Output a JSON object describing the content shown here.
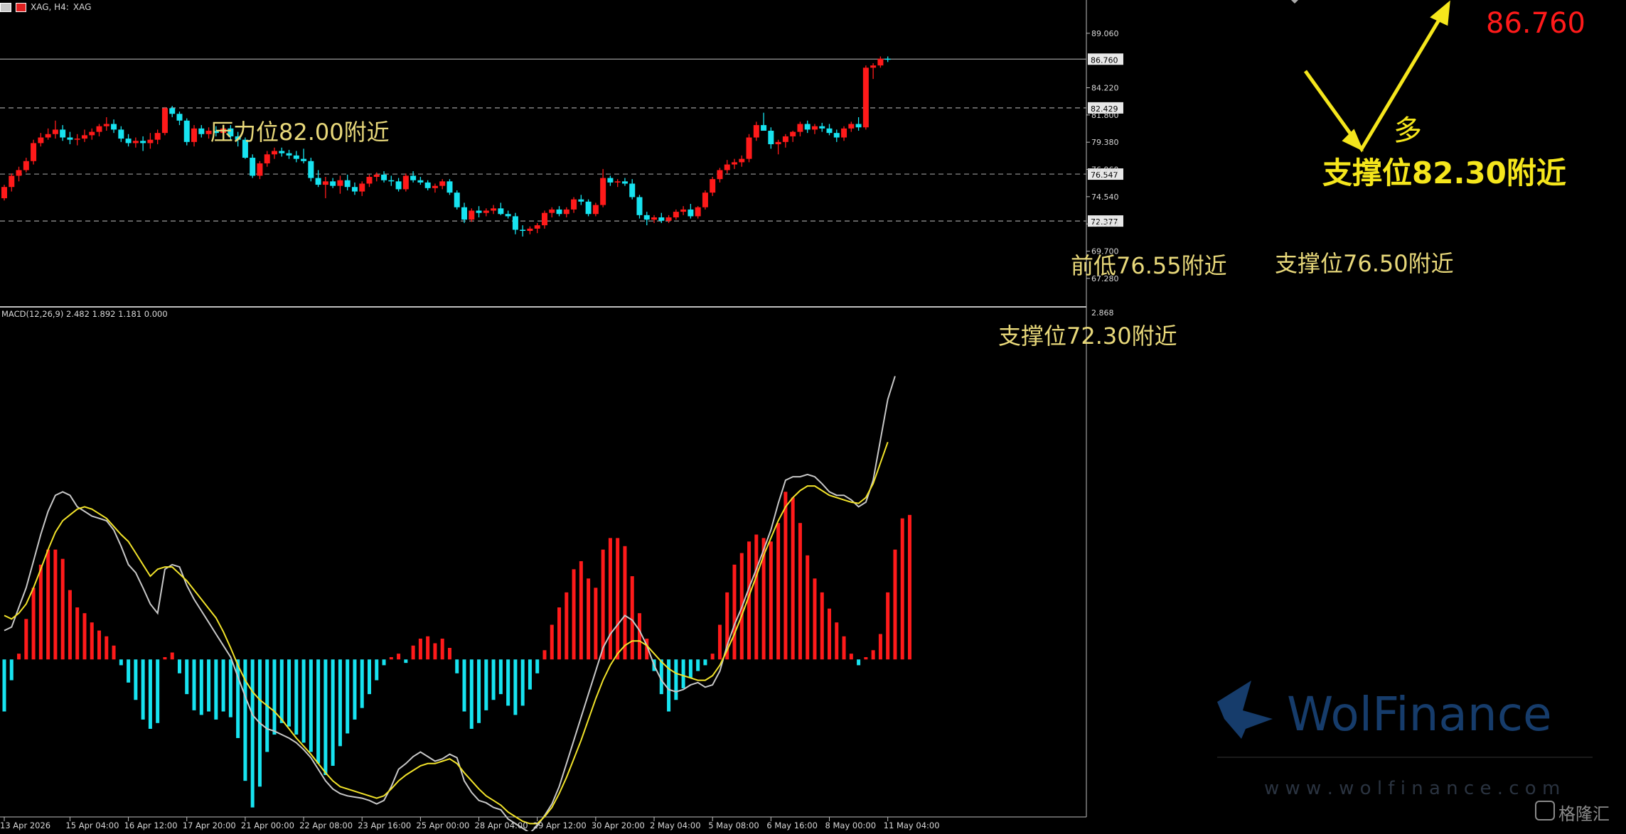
{
  "header": {
    "symbol": "XAG, H4:",
    "symbol_short": "XAG"
  },
  "macd_label": "MACD(12,26,9) 2.482 1.892 1.181 0.000",
  "big_price": "86.760",
  "colors": {
    "bull": "#ff1a1a",
    "bear": "#17e3f0",
    "annot": "#f5e61c",
    "annot_soft": "#e8d87a",
    "signal": "#f2e32a",
    "macd_line": "#c8c8c8",
    "grid": "#9a9a9a",
    "price_big": "#ff1a1a"
  },
  "annotations": {
    "resistance": "压力位82.00附近",
    "support_big": "支撑位82.30附近",
    "long": "多",
    "prev_low": "前低76.55附近",
    "support_mid": "支撑位76.50附近",
    "support_low": "支撑位72.30附近"
  },
  "watermark": {
    "brand": "WolFinance",
    "url": "w w w . w o l f i n a n c e . c o m",
    "corner": "格隆汇"
  },
  "chart_data": [
    {
      "type": "candlestick",
      "title": "XAG, H4",
      "y_ticks": [
        "89.060",
        "84.220",
        "81.800",
        "79.380",
        "76.960",
        "74.540",
        "72.120",
        "69.700",
        "67.280"
      ],
      "y_tick_values": [
        89.06,
        84.22,
        81.8,
        79.38,
        76.96,
        74.54,
        72.12,
        69.7,
        67.28
      ],
      "ylim": [
        65.0,
        90.5
      ],
      "x_ticks": [
        "13 Apr 2026",
        "15 Apr 04:00",
        "16 Apr 12:00",
        "17 Apr 20:00",
        "21 Apr 00:00",
        "22 Apr 08:00",
        "23 Apr 16:00",
        "25 Apr 00:00",
        "28 Apr 04:00",
        "29 Apr 12:00",
        "30 Apr 20:00",
        "2 May 04:00",
        "5 May 08:00",
        "6 May 16:00",
        "8 May 00:00",
        "11 May 04:00"
      ],
      "x_tick_index": [
        0,
        9,
        17,
        25,
        33,
        41,
        49,
        57,
        65,
        73,
        81,
        89,
        97,
        105,
        113,
        121
      ],
      "hlines": [
        {
          "value": 86.76,
          "label": "86.760",
          "style": "solid"
        },
        {
          "value": 82.429,
          "label": "82.429",
          "style": "dashed"
        },
        {
          "value": 76.547,
          "label": "76.547",
          "style": "dashed"
        },
        {
          "value": 72.377,
          "label": "72.377",
          "style": "dashed"
        }
      ],
      "candles": [
        [
          74.4,
          75.6,
          74.2,
          75.4
        ],
        [
          75.4,
          76.6,
          75.0,
          76.4
        ],
        [
          76.4,
          77.2,
          75.9,
          76.9
        ],
        [
          76.9,
          78.0,
          76.7,
          77.7
        ],
        [
          77.7,
          79.6,
          77.4,
          79.3
        ],
        [
          79.3,
          80.2,
          79.0,
          79.8
        ],
        [
          79.8,
          80.6,
          79.6,
          80.1
        ],
        [
          80.1,
          81.3,
          79.7,
          80.5
        ],
        [
          80.5,
          80.9,
          79.5,
          79.8
        ],
        [
          79.8,
          80.3,
          79.2,
          79.6
        ],
        [
          79.6,
          80.1,
          79.1,
          79.7
        ],
        [
          79.7,
          80.5,
          79.4,
          80.0
        ],
        [
          80.0,
          80.6,
          79.6,
          80.3
        ],
        [
          80.3,
          81.0,
          79.9,
          80.8
        ],
        [
          80.8,
          81.6,
          80.4,
          81.0
        ],
        [
          81.0,
          81.4,
          80.2,
          80.5
        ],
        [
          80.5,
          80.8,
          79.4,
          79.7
        ],
        [
          79.7,
          80.1,
          79.0,
          79.3
        ],
        [
          79.3,
          79.8,
          78.9,
          79.5
        ],
        [
          79.5,
          79.9,
          78.6,
          79.3
        ],
        [
          79.3,
          80.2,
          78.8,
          79.6
        ],
        [
          79.6,
          80.5,
          79.2,
          80.2
        ],
        [
          80.2,
          82.5,
          80.0,
          82.4
        ],
        [
          82.4,
          82.6,
          81.6,
          81.9
        ],
        [
          81.9,
          82.1,
          80.9,
          81.3
        ],
        [
          81.3,
          81.5,
          79.1,
          79.4
        ],
        [
          79.4,
          80.9,
          79.0,
          80.6
        ],
        [
          80.6,
          80.9,
          79.8,
          80.1
        ],
        [
          80.1,
          80.7,
          79.7,
          80.4
        ],
        [
          80.4,
          80.8,
          79.9,
          80.2
        ],
        [
          80.2,
          80.9,
          79.9,
          80.6
        ],
        [
          80.6,
          80.9,
          79.6,
          79.9
        ],
        [
          79.9,
          80.3,
          79.0,
          79.6
        ],
        [
          79.6,
          79.8,
          77.9,
          78.0
        ],
        [
          78.0,
          78.3,
          76.2,
          76.4
        ],
        [
          76.4,
          77.7,
          76.1,
          77.5
        ],
        [
          77.5,
          78.6,
          77.2,
          78.3
        ],
        [
          78.3,
          78.9,
          77.9,
          78.6
        ],
        [
          78.6,
          78.9,
          78.1,
          78.4
        ],
        [
          78.4,
          78.7,
          77.9,
          78.2
        ],
        [
          78.2,
          78.6,
          77.6,
          77.9
        ],
        [
          77.9,
          78.8,
          77.5,
          77.7
        ],
        [
          77.7,
          78.0,
          75.9,
          76.2
        ],
        [
          76.2,
          76.9,
          75.4,
          75.6
        ],
        [
          75.6,
          76.3,
          74.4,
          75.9
        ],
        [
          75.9,
          76.2,
          75.3,
          75.5
        ],
        [
          75.5,
          76.4,
          74.8,
          76.0
        ],
        [
          76.0,
          76.5,
          75.1,
          75.4
        ],
        [
          75.4,
          75.8,
          74.7,
          75.0
        ],
        [
          75.0,
          75.9,
          74.6,
          75.7
        ],
        [
          75.7,
          76.5,
          75.4,
          76.3
        ],
        [
          76.3,
          76.7,
          75.9,
          76.5
        ],
        [
          76.5,
          76.8,
          75.8,
          76.0
        ],
        [
          76.0,
          76.4,
          75.5,
          75.9
        ],
        [
          75.9,
          76.2,
          75.0,
          75.2
        ],
        [
          75.2,
          76.6,
          75.0,
          76.4
        ],
        [
          76.4,
          76.8,
          75.8,
          76.0
        ],
        [
          76.0,
          76.3,
          75.6,
          75.8
        ],
        [
          75.8,
          76.0,
          75.1,
          75.3
        ],
        [
          75.3,
          75.7,
          74.9,
          75.5
        ],
        [
          75.5,
          76.1,
          75.2,
          75.9
        ],
        [
          75.9,
          76.1,
          74.7,
          74.9
        ],
        [
          74.9,
          75.1,
          73.4,
          73.6
        ],
        [
          73.6,
          74.0,
          72.2,
          72.5
        ],
        [
          72.5,
          73.5,
          72.3,
          73.3
        ],
        [
          73.3,
          73.7,
          72.7,
          73.1
        ],
        [
          73.1,
          73.5,
          72.8,
          73.3
        ],
        [
          73.3,
          73.8,
          73.0,
          73.5
        ],
        [
          73.5,
          74.0,
          72.9,
          73.0
        ],
        [
          73.0,
          73.3,
          72.6,
          72.8
        ],
        [
          72.8,
          73.1,
          71.2,
          71.6
        ],
        [
          71.6,
          72.0,
          71.0,
          71.5
        ],
        [
          71.5,
          71.9,
          71.2,
          71.7
        ],
        [
          71.7,
          72.2,
          71.3,
          72.0
        ],
        [
          72.0,
          73.3,
          71.7,
          73.1
        ],
        [
          73.1,
          73.6,
          72.7,
          73.4
        ],
        [
          73.4,
          73.7,
          72.8,
          73.0
        ],
        [
          73.0,
          73.6,
          72.7,
          73.4
        ],
        [
          73.4,
          74.5,
          73.1,
          74.3
        ],
        [
          74.3,
          74.7,
          73.8,
          74.1
        ],
        [
          74.1,
          74.3,
          72.8,
          73.0
        ],
        [
          73.0,
          74.0,
          72.8,
          73.8
        ],
        [
          73.8,
          77.0,
          73.6,
          76.2
        ],
        [
          76.2,
          76.4,
          75.5,
          75.8
        ],
        [
          75.8,
          76.1,
          75.4,
          75.9
        ],
        [
          75.9,
          76.2,
          75.5,
          75.7
        ],
        [
          75.7,
          76.1,
          74.3,
          74.5
        ],
        [
          74.5,
          74.7,
          72.6,
          72.9
        ],
        [
          72.9,
          73.2,
          72.0,
          72.5
        ],
        [
          72.5,
          72.9,
          72.2,
          72.7
        ],
        [
          72.7,
          73.1,
          72.2,
          72.4
        ],
        [
          72.4,
          72.9,
          72.2,
          72.7
        ],
        [
          72.7,
          73.4,
          72.5,
          73.2
        ],
        [
          73.2,
          73.7,
          72.9,
          73.4
        ],
        [
          73.4,
          73.9,
          72.6,
          72.8
        ],
        [
          72.8,
          73.7,
          72.6,
          73.6
        ],
        [
          73.6,
          75.1,
          73.4,
          74.9
        ],
        [
          74.9,
          76.3,
          74.6,
          76.1
        ],
        [
          76.1,
          77.1,
          75.8,
          76.9
        ],
        [
          76.9,
          77.8,
          76.6,
          77.4
        ],
        [
          77.4,
          77.9,
          77.0,
          77.6
        ],
        [
          77.6,
          78.2,
          77.2,
          77.9
        ],
        [
          77.9,
          80.1,
          77.6,
          79.8
        ],
        [
          79.8,
          81.2,
          79.5,
          80.9
        ],
        [
          80.9,
          82.0,
          80.5,
          80.4
        ],
        [
          80.4,
          80.7,
          78.8,
          79.2
        ],
        [
          79.2,
          79.6,
          78.3,
          79.4
        ],
        [
          79.4,
          80.1,
          78.9,
          79.9
        ],
        [
          79.9,
          80.4,
          79.4,
          80.3
        ],
        [
          80.3,
          81.2,
          79.9,
          81.0
        ],
        [
          81.0,
          81.3,
          80.2,
          80.5
        ],
        [
          80.5,
          81.0,
          80.1,
          80.8
        ],
        [
          80.8,
          81.1,
          80.3,
          80.6
        ],
        [
          80.6,
          81.0,
          80.0,
          80.2
        ],
        [
          80.2,
          80.5,
          79.4,
          79.8
        ],
        [
          79.8,
          80.8,
          79.5,
          80.6
        ],
        [
          80.6,
          81.2,
          80.3,
          81.0
        ],
        [
          81.0,
          81.6,
          80.4,
          80.7
        ],
        [
          80.7,
          86.2,
          80.5,
          86.0
        ],
        [
          86.0,
          86.4,
          85.0,
          86.2
        ],
        [
          86.2,
          87.0,
          86.0,
          86.8
        ],
        [
          86.8,
          87.0,
          86.5,
          86.76
        ]
      ]
    },
    {
      "type": "bar",
      "title": "MACD(12,26,9)",
      "values_label": [
        "2.482",
        "1.892",
        "1.181",
        "0.000"
      ],
      "y_ticks": [
        "2.868"
      ],
      "ylim": [
        -1.35,
        3.0
      ],
      "hist": [
        -0.45,
        -0.18,
        0.05,
        0.35,
        0.62,
        0.82,
        0.95,
        0.95,
        0.87,
        0.6,
        0.45,
        0.4,
        0.32,
        0.25,
        0.2,
        0.12,
        -0.05,
        -0.2,
        -0.35,
        -0.52,
        -0.6,
        -0.55,
        0.02,
        0.06,
        -0.12,
        -0.3,
        -0.44,
        -0.48,
        -0.45,
        -0.52,
        -0.45,
        -0.5,
        -0.68,
        -1.05,
        -1.28,
        -1.1,
        -0.8,
        -0.65,
        -0.55,
        -0.58,
        -0.65,
        -0.72,
        -0.8,
        -0.9,
        -1.0,
        -0.92,
        -0.75,
        -0.64,
        -0.52,
        -0.42,
        -0.3,
        -0.18,
        -0.05,
        0.02,
        0.05,
        -0.03,
        0.12,
        0.18,
        0.2,
        0.14,
        0.18,
        0.1,
        -0.12,
        -0.45,
        -0.6,
        -0.55,
        -0.44,
        -0.35,
        -0.3,
        -0.4,
        -0.48,
        -0.4,
        -0.26,
        -0.12,
        0.08,
        0.3,
        0.45,
        0.58,
        0.78,
        0.85,
        0.7,
        0.62,
        0.95,
        1.05,
        1.05,
        0.98,
        0.72,
        0.4,
        0.18,
        -0.1,
        -0.3,
        -0.45,
        -0.35,
        -0.25,
        -0.16,
        -0.1,
        -0.05,
        0.05,
        0.3,
        0.58,
        0.82,
        0.92,
        1.02,
        1.08,
        1.05,
        1.02,
        1.18,
        1.45,
        1.4,
        1.18,
        0.9,
        0.7,
        0.58,
        0.44,
        0.32,
        0.2,
        0.05,
        -0.05,
        0.02,
        0.08,
        0.22,
        0.58,
        0.95,
        1.22,
        1.25
      ],
      "macd": [
        0.25,
        0.28,
        0.45,
        0.62,
        0.85,
        1.08,
        1.28,
        1.42,
        1.45,
        1.42,
        1.32,
        1.28,
        1.24,
        1.22,
        1.2,
        1.12,
        0.98,
        0.82,
        0.75,
        0.62,
        0.48,
        0.4,
        0.78,
        0.82,
        0.8,
        0.64,
        0.52,
        0.42,
        0.32,
        0.22,
        0.12,
        0.02,
        -0.15,
        -0.32,
        -0.48,
        -0.55,
        -0.6,
        -0.62,
        -0.65,
        -0.68,
        -0.72,
        -0.78,
        -0.85,
        -0.95,
        -1.05,
        -1.12,
        -1.16,
        -1.18,
        -1.19,
        -1.2,
        -1.22,
        -1.25,
        -1.22,
        -1.1,
        -0.95,
        -0.9,
        -0.84,
        -0.8,
        -0.84,
        -0.88,
        -0.86,
        -0.82,
        -0.85,
        -1.05,
        -1.15,
        -1.22,
        -1.24,
        -1.28,
        -1.3,
        -1.38,
        -1.42,
        -1.46,
        -1.5,
        -1.44,
        -1.35,
        -1.25,
        -1.1,
        -0.9,
        -0.7,
        -0.5,
        -0.3,
        -0.1,
        0.1,
        0.22,
        0.3,
        0.38,
        0.34,
        0.25,
        0.12,
        -0.05,
        -0.18,
        -0.26,
        -0.28,
        -0.26,
        -0.22,
        -0.2,
        -0.24,
        -0.22,
        -0.1,
        0.12,
        0.3,
        0.45,
        0.62,
        0.78,
        0.95,
        1.12,
        1.35,
        1.55,
        1.58,
        1.58,
        1.6,
        1.58,
        1.52,
        1.45,
        1.42,
        1.42,
        1.38,
        1.32,
        1.36,
        1.55,
        1.9,
        2.25,
        2.45
      ],
      "signal": [
        0.38,
        0.35,
        0.4,
        0.48,
        0.62,
        0.78,
        0.95,
        1.1,
        1.2,
        1.25,
        1.3,
        1.32,
        1.3,
        1.26,
        1.22,
        1.15,
        1.08,
        1.02,
        0.92,
        0.82,
        0.72,
        0.78,
        0.8,
        0.8,
        0.74,
        0.68,
        0.6,
        0.52,
        0.44,
        0.36,
        0.24,
        0.1,
        -0.05,
        -0.18,
        -0.28,
        -0.35,
        -0.4,
        -0.45,
        -0.52,
        -0.6,
        -0.68,
        -0.75,
        -0.82,
        -0.9,
        -0.98,
        -1.05,
        -1.1,
        -1.12,
        -1.14,
        -1.16,
        -1.18,
        -1.2,
        -1.18,
        -1.12,
        -1.05,
        -1.0,
        -0.96,
        -0.92,
        -0.9,
        -0.9,
        -0.88,
        -0.86,
        -0.9,
        -0.98,
        -1.05,
        -1.12,
        -1.18,
        -1.22,
        -1.26,
        -1.32,
        -1.36,
        -1.4,
        -1.42,
        -1.42,
        -1.36,
        -1.28,
        -1.16,
        -1.02,
        -0.86,
        -0.7,
        -0.52,
        -0.34,
        -0.18,
        -0.05,
        0.05,
        0.12,
        0.16,
        0.16,
        0.12,
        0.05,
        -0.02,
        -0.08,
        -0.12,
        -0.14,
        -0.16,
        -0.18,
        -0.18,
        -0.14,
        -0.05,
        0.08,
        0.22,
        0.38,
        0.55,
        0.72,
        0.9,
        1.05,
        1.2,
        1.32,
        1.4,
        1.46,
        1.5,
        1.5,
        1.46,
        1.42,
        1.4,
        1.38,
        1.36,
        1.35,
        1.4,
        1.52,
        1.7,
        1.88
      ]
    }
  ]
}
